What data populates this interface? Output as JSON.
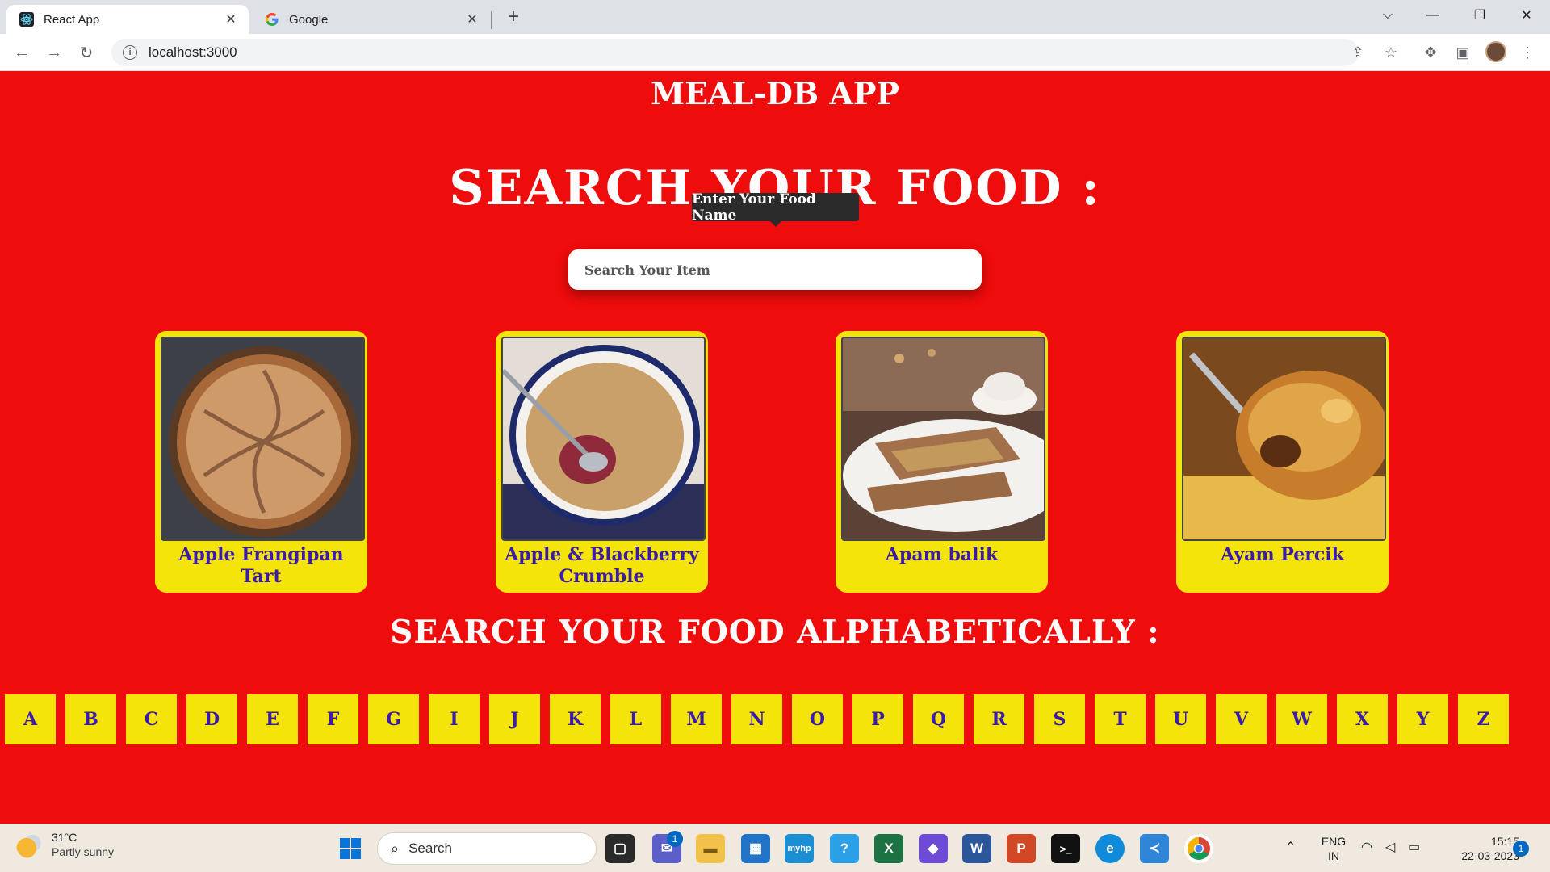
{
  "browser": {
    "tabs": [
      {
        "title": "React App",
        "active": true
      },
      {
        "title": "Google",
        "active": false
      }
    ],
    "url": "localhost:3000"
  },
  "app": {
    "title": "MEAL-DB APP",
    "search_heading": "SEARCH YOUR FOOD :",
    "tooltip": "Enter Your Food Name",
    "search_placeholder": "Search Your Item",
    "meals": [
      {
        "name": "Apple Frangipan Tart"
      },
      {
        "name": "Apple & Blackberry Crumble"
      },
      {
        "name": "Apam balik"
      },
      {
        "name": "Ayam Percik"
      }
    ],
    "alpha_heading": "SEARCH YOUR FOOD ALPHABETICALLY :",
    "letters": [
      "A",
      "B",
      "C",
      "D",
      "E",
      "F",
      "G",
      "I",
      "J",
      "K",
      "L",
      "M",
      "N",
      "O",
      "P",
      "Q",
      "R",
      "S",
      "T",
      "U",
      "V",
      "W",
      "X",
      "Y",
      "Z"
    ]
  },
  "taskbar": {
    "weather_temp": "31°C",
    "weather_condition": "Partly sunny",
    "search_label": "Search",
    "teams_badge": "1",
    "lang_top": "ENG",
    "lang_bottom": "IN",
    "time": "15:15",
    "date": "22-03-2023",
    "notification_count": "1"
  },
  "colors": {
    "page_background": "#ee0c0c",
    "card_background": "#f5e40a",
    "card_text": "#3a1ca8",
    "heading_text": "#ffffff"
  }
}
